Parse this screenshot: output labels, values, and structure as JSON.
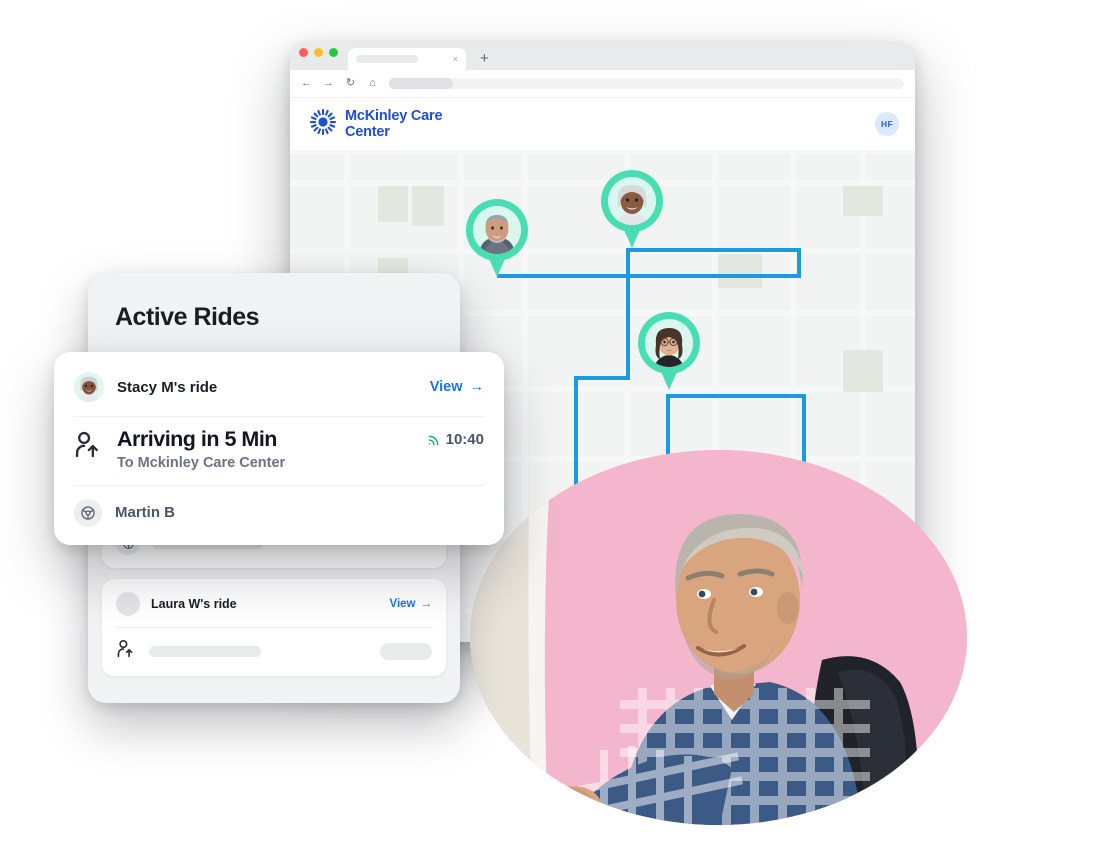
{
  "browser": {
    "tab_title": "",
    "close_tab_label": "×",
    "new_tab_label": "+",
    "nav": {
      "back": "←",
      "forward": "→",
      "reload": "↻",
      "home": "⌂"
    },
    "url": ""
  },
  "app": {
    "brand": "McKinley Care\nCenter",
    "user_initials": "HF",
    "logo_icon": "sunburst-icon",
    "accent_blue": "#1d4ed8"
  },
  "map": {
    "route_color": "#1a9ae0",
    "pin_color": "#49ddb4",
    "pins": [
      {
        "name": "pin-rider-1",
        "alt": "smiling older man"
      },
      {
        "name": "pin-rider-2",
        "alt": "smiling older woman with grey hair"
      },
      {
        "name": "pin-rider-3",
        "alt": "woman with glasses"
      }
    ]
  },
  "panel": {
    "title": "Active Rides",
    "cards": [
      {
        "name": "",
        "view_label": "",
        "arrow": "",
        "placeholder": true
      },
      {
        "name": "Laura W's ride",
        "view_label": "View",
        "arrow": "→",
        "placeholder": false
      }
    ]
  },
  "detail_card": {
    "rider_name": "Stacy M's ride",
    "view_label": "View",
    "view_arrow": "→",
    "eta": "Arriving in 5 Min",
    "destination": "To Mckinley Care Center",
    "time": "10:40",
    "signal_icon": "signal-icon",
    "signal_color": "#1fae6a",
    "pickup_icon": "person-pickup-icon",
    "driver_icon": "steering-wheel-icon",
    "driver_name": "Martin B",
    "link_color": "#1a73e8"
  },
  "hero": {
    "alt": "older man in checked shirt at computer",
    "background": "#f4b6cd"
  }
}
